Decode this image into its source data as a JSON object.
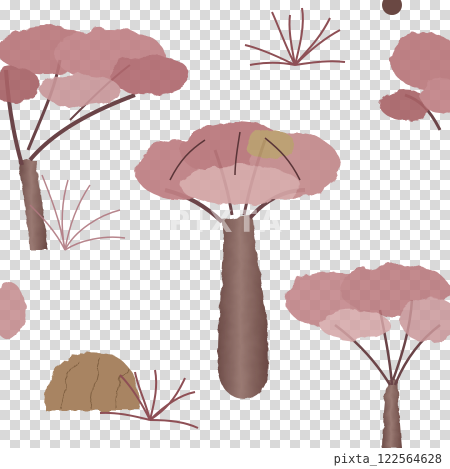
{
  "image": {
    "subject": "watercolor trees",
    "background": "transparent checkerboard",
    "watermark_text": "PIXTA",
    "image_id": "pixta_122564628"
  },
  "palette": {
    "canopy_pink": "#b9767a",
    "canopy_dark": "#8e4f55",
    "canopy_light": "#d4a5a6",
    "trunk_brown": "#7e5a55",
    "trunk_light": "#a6837b",
    "shrub_ochre": "#a88462",
    "shrub_pink": "#a8676b",
    "branch_dark": "#5a3538"
  }
}
